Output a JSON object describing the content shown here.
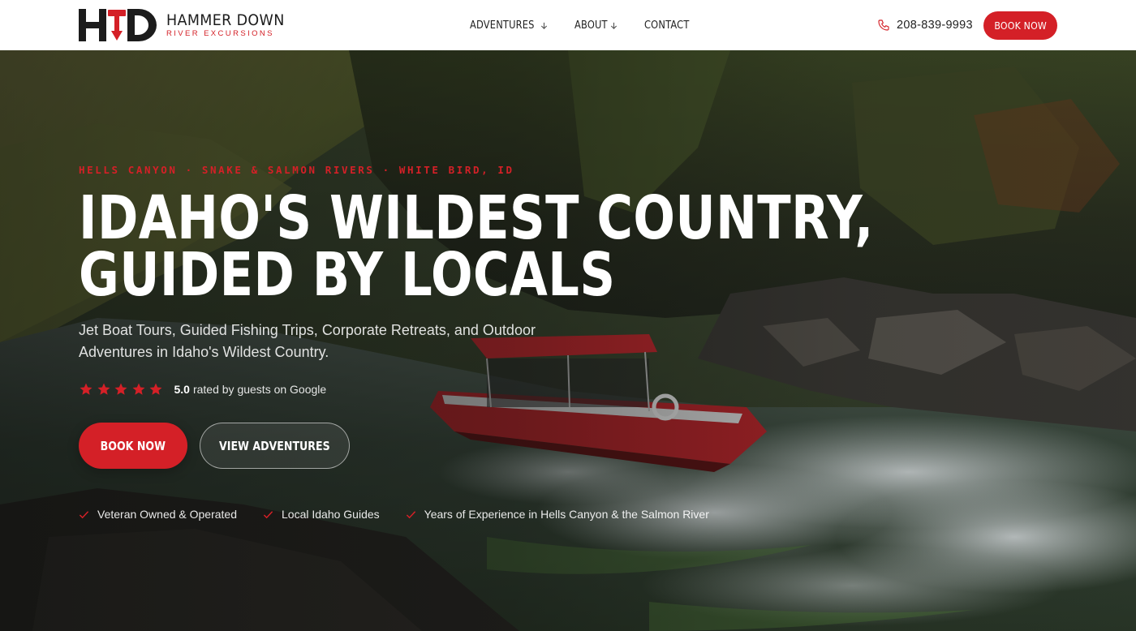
{
  "header": {
    "logo": {
      "mark": "HD",
      "name": "HAMMER DOWN",
      "subtitle": "RIVER EXCURSIONS",
      "icon": "hammer-icon"
    },
    "nav": [
      {
        "label": "ADVENTURES",
        "has_dropdown": true,
        "icon": "arrow-down-icon"
      },
      {
        "label": "ABOUT",
        "has_dropdown": true,
        "icon": "arrow-down-icon"
      },
      {
        "label": "CONTACT",
        "has_dropdown": false
      }
    ],
    "phone": {
      "icon": "phone-icon",
      "number": "208-839-9993"
    },
    "book_label": "BOOK NOW"
  },
  "hero": {
    "eyebrow": "HELLS CANYON · SNAKE & SALMON RIVERS · WHITE BIRD, ID",
    "headline_line1": "IDAHO'S WILDEST COUNTRY,",
    "headline_line2": "GUIDED BY LOCALS",
    "subhead": "Jet Boat Tours, Guided Fishing Trips, Corporate Retreats, and Outdoor Adventures in Idaho's Wildest Country.",
    "rating": {
      "stars": 5,
      "score": "5.0",
      "text": "rated by guests on Google",
      "icon": "star-icon"
    },
    "primary_cta": "BOOK NOW",
    "secondary_cta": "VIEW ADVENTURES",
    "features": [
      "Veteran Owned & Operated",
      "Local Idaho Guides",
      "Years of Experience in Hells Canyon & the Salmon River"
    ],
    "background": "jet boat in river rapids"
  },
  "colors": {
    "accent": "#d42027",
    "header_bg": "#ffffff",
    "text_dark": "#222222",
    "hero_text": "#ffffff"
  }
}
